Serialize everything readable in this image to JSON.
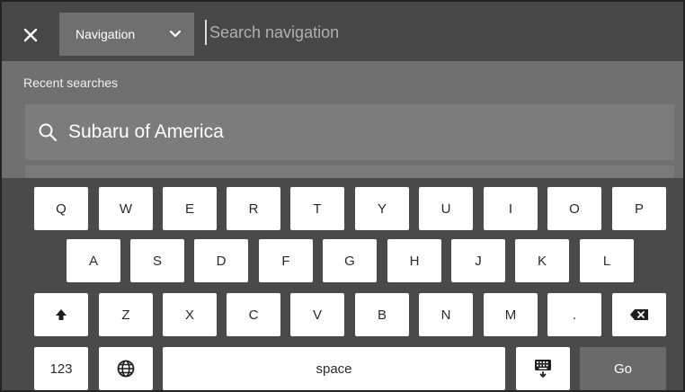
{
  "header": {
    "category": "Navigation",
    "search_placeholder": "Search navigation",
    "close_icon": "close-icon"
  },
  "results": {
    "heading": "Recent searches",
    "items": [
      {
        "label": "Subaru of America",
        "icon": "search-icon"
      }
    ]
  },
  "keyboard": {
    "row1": [
      "Q",
      "W",
      "E",
      "R",
      "T",
      "Y",
      "U",
      "I",
      "O",
      "P"
    ],
    "row2": [
      "A",
      "S",
      "D",
      "F",
      "G",
      "H",
      "J",
      "K",
      "L"
    ],
    "row3": [
      "Z",
      "X",
      "C",
      "V",
      "B",
      "N",
      "M",
      "."
    ],
    "numbers_label": "123",
    "space_label": "space",
    "go_label": "Go",
    "icons": {
      "shift": "shift-icon",
      "backspace": "backspace-icon",
      "language": "globe-icon",
      "hide_keyboard": "hide-keyboard-icon"
    }
  },
  "colors": {
    "topbar": "#474747",
    "panel": "#707070",
    "keyboard": "#4a4a4a",
    "key": "#ffffff",
    "go_key": "#6a6a6a"
  }
}
